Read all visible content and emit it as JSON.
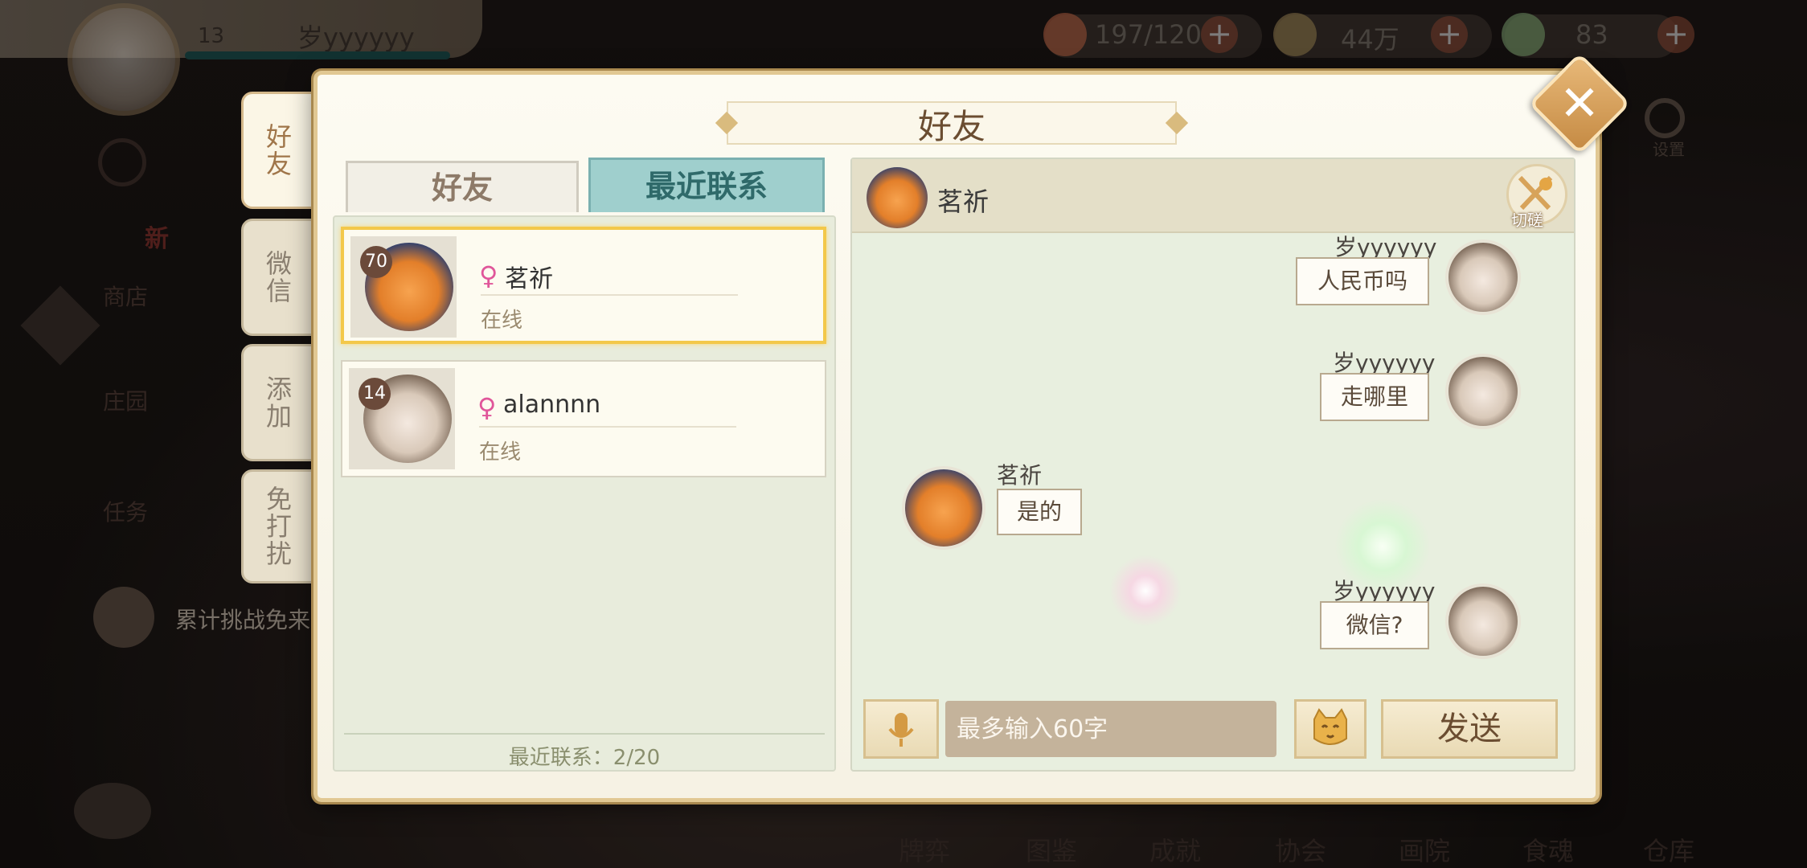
{
  "hud": {
    "player_level": "13",
    "player_name": "岁yyyyyy",
    "resource_stamina": "197/120",
    "resource_coins": "44万",
    "resource_gems": "83",
    "settings_label": "设置"
  },
  "side_menu": {
    "shop": "商店",
    "shop_badge": "新",
    "manor": "庄园",
    "tasks": "任务",
    "notice": "累计挑战免来"
  },
  "bottom_menu": [
    "牌弈",
    "图鉴",
    "成就",
    "协会",
    "画院",
    "食魂",
    "仓库"
  ],
  "vertical_tabs": [
    "好友",
    "微信",
    "添加",
    "免打扰"
  ],
  "dialog": {
    "title": "好友",
    "close_symbol": "✕"
  },
  "list_tabs": {
    "friends": "好友",
    "recent": "最近联系"
  },
  "contacts": [
    {
      "level": "70",
      "gender_symbol": "♀",
      "name": "茗祈",
      "status": "在线",
      "selected": true
    },
    {
      "level": "14",
      "gender_symbol": "♀",
      "name": "alannnn",
      "status": "在线",
      "selected": false
    }
  ],
  "recent_count": "最近联系：2/20",
  "chat": {
    "partner_name": "茗祈",
    "duel_label": "切磋",
    "messages": [
      {
        "sender": "岁yyyyyy",
        "text": "人民币吗",
        "side": "right"
      },
      {
        "sender": "岁yyyyyy",
        "text": "走哪里",
        "side": "right"
      },
      {
        "sender": "茗祈",
        "text": "是的",
        "side": "left"
      },
      {
        "sender": "岁yyyyyy",
        "text": "微信?",
        "side": "right"
      }
    ],
    "input_placeholder": "最多输入60字",
    "send_label": "发送"
  },
  "colors": {
    "accent_gold": "#e1c893",
    "tab_active_teal": "#9fcfcd",
    "selected_border": "#f3c84a",
    "gender_female": "#e0569a"
  }
}
